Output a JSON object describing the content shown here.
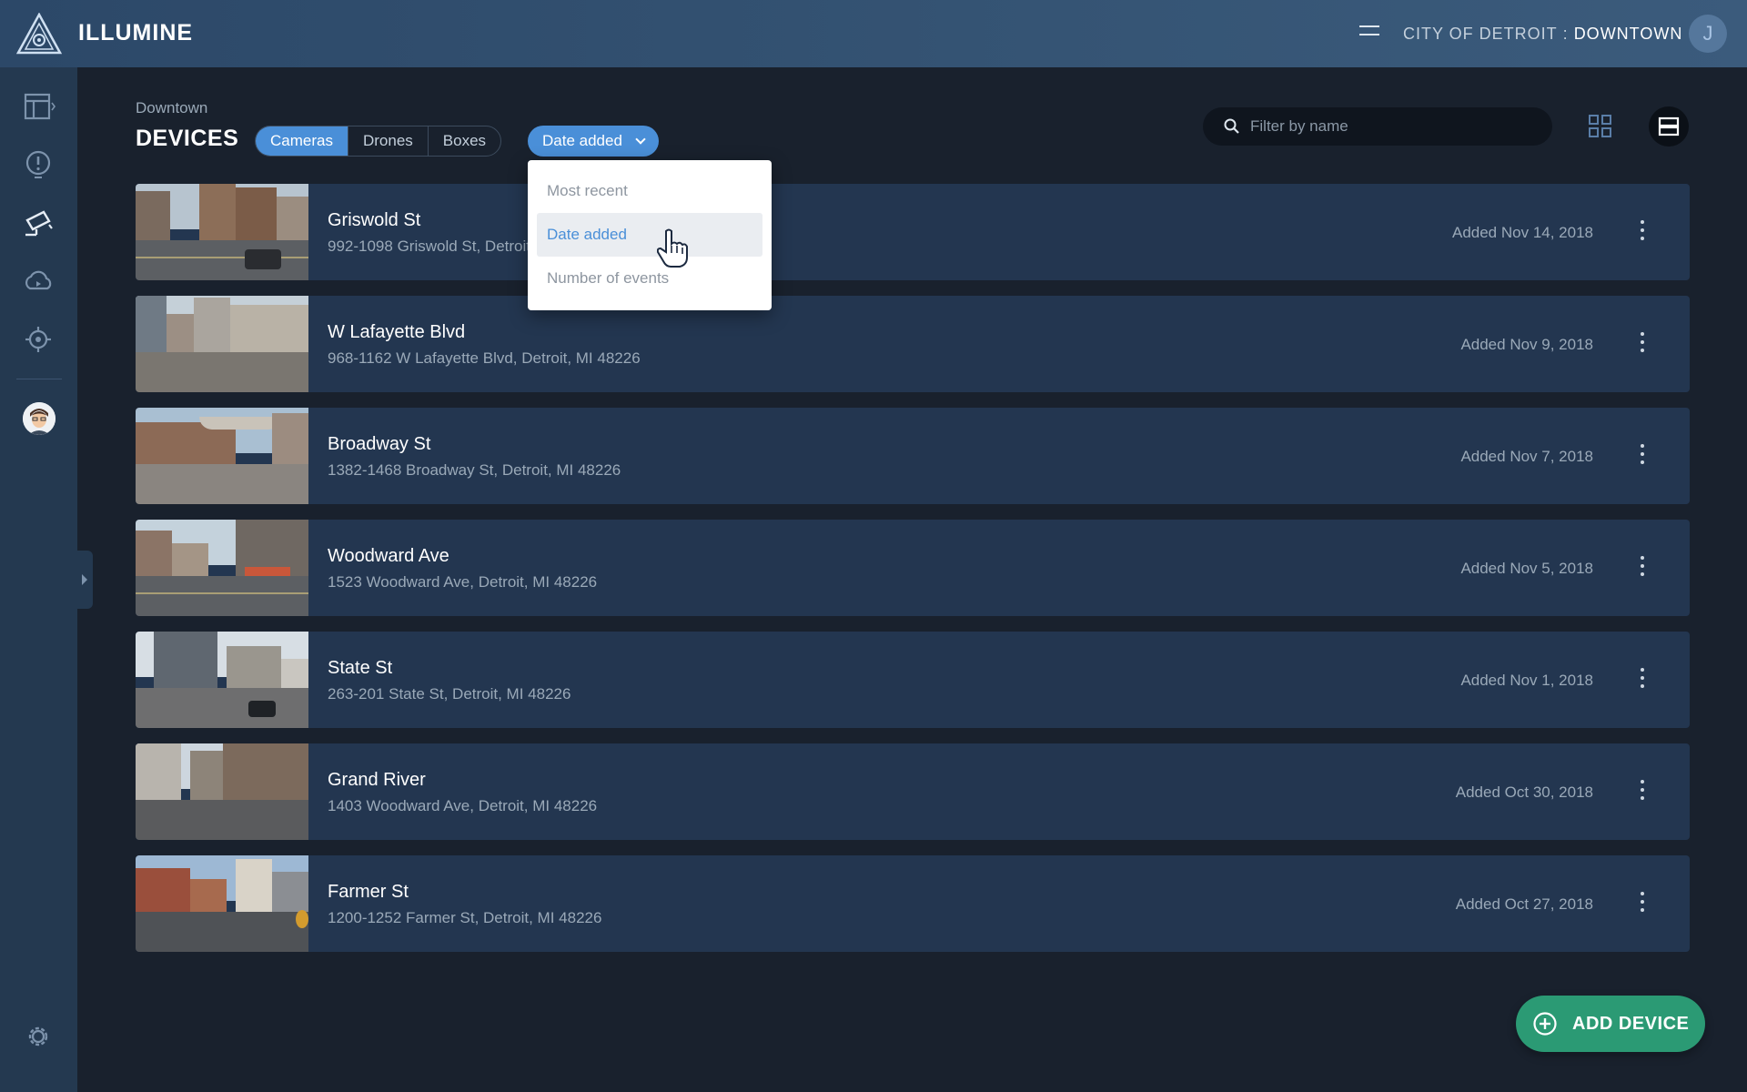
{
  "app": {
    "brand": "ILLUMINE",
    "city": "CITY OF DETROIT",
    "separator": ":",
    "district": "DOWNTOWN",
    "user_initial": "J"
  },
  "header": {
    "breadcrumb": "Downtown",
    "title": "DEVICES",
    "tabs": [
      {
        "label": "Cameras",
        "active": true
      },
      {
        "label": "Drones",
        "active": false
      },
      {
        "label": "Boxes",
        "active": false
      }
    ],
    "sort_label": "Date added",
    "search_placeholder": "Filter by name"
  },
  "sort_menu": {
    "options": [
      {
        "label": "Most recent",
        "active": false
      },
      {
        "label": "Date added",
        "active": true
      },
      {
        "label": "Number of events",
        "active": false
      }
    ]
  },
  "devices": [
    {
      "name": "Griswold St",
      "address": "992-1098 Griswold St, Detroit, MI 48226",
      "added": "Added Nov 14, 2018"
    },
    {
      "name": "W Lafayette Blvd",
      "address": "968-1162 W Lafayette Blvd, Detroit, MI 48226",
      "added": "Added Nov 9, 2018"
    },
    {
      "name": "Broadway St",
      "address": "1382-1468 Broadway St, Detroit, MI 48226",
      "added": "Added Nov 7, 2018"
    },
    {
      "name": "Woodward Ave",
      "address": "1523 Woodward Ave, Detroit, MI 48226",
      "added": "Added Nov 5, 2018"
    },
    {
      "name": "State St",
      "address": "263-201 State St, Detroit, MI 48226",
      "added": "Added Nov 1, 2018"
    },
    {
      "name": "Grand River",
      "address": "1403 Woodward Ave, Detroit, MI 48226",
      "added": "Added Oct 30, 2018"
    },
    {
      "name": "Farmer St",
      "address": "1200-1252 Farmer St, Detroit, MI 48226",
      "added": "Added Oct 27, 2018"
    }
  ],
  "sidebar": {
    "icons": [
      "dashboard-icon",
      "alert-icon",
      "camera-icon",
      "cloud-icon",
      "target-icon",
      "settings-icon"
    ]
  },
  "actions": {
    "add_device": "ADD DEVICE"
  },
  "colors": {
    "accent": "#4a8fd8",
    "add_button": "#2b9a74",
    "row_bg": "#233650",
    "page_bg": "#19212d"
  }
}
